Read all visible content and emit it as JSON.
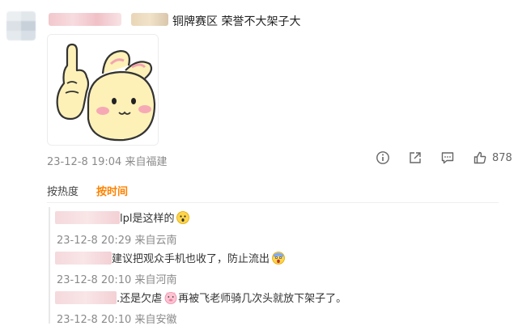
{
  "post": {
    "text": "铜牌赛区 荣誉不大架子大",
    "timestamp": "23-12-8 19:04",
    "location": "来自福建",
    "like_count": "878"
  },
  "actions": {
    "icons": [
      "info-icon",
      "share-icon",
      "comment-icon",
      "like-icon"
    ]
  },
  "sort": {
    "hot_label": "按热度",
    "time_label": "按时间",
    "active": "time"
  },
  "replies": [
    {
      "text": "lpl是这样的",
      "emoji": "surprised-face-emoji",
      "timestamp": "23-12-8 20:29",
      "location": "来自云南"
    },
    {
      "text": "建议把观众手机也收了，防止流出",
      "emoji": "screaming-face-emoji",
      "timestamp": "23-12-8 20:10",
      "location": "来自河南"
    },
    {
      "text": ".还是欠虐",
      "emoji": "pig-face-emoji",
      "text_after": " 再被飞老师骑几次头就放下架子了。",
      "timestamp": "23-12-8 20:10",
      "location": "来自安徽"
    }
  ],
  "colors": {
    "accent": "#ff8200",
    "meta": "#8a8a8a"
  }
}
